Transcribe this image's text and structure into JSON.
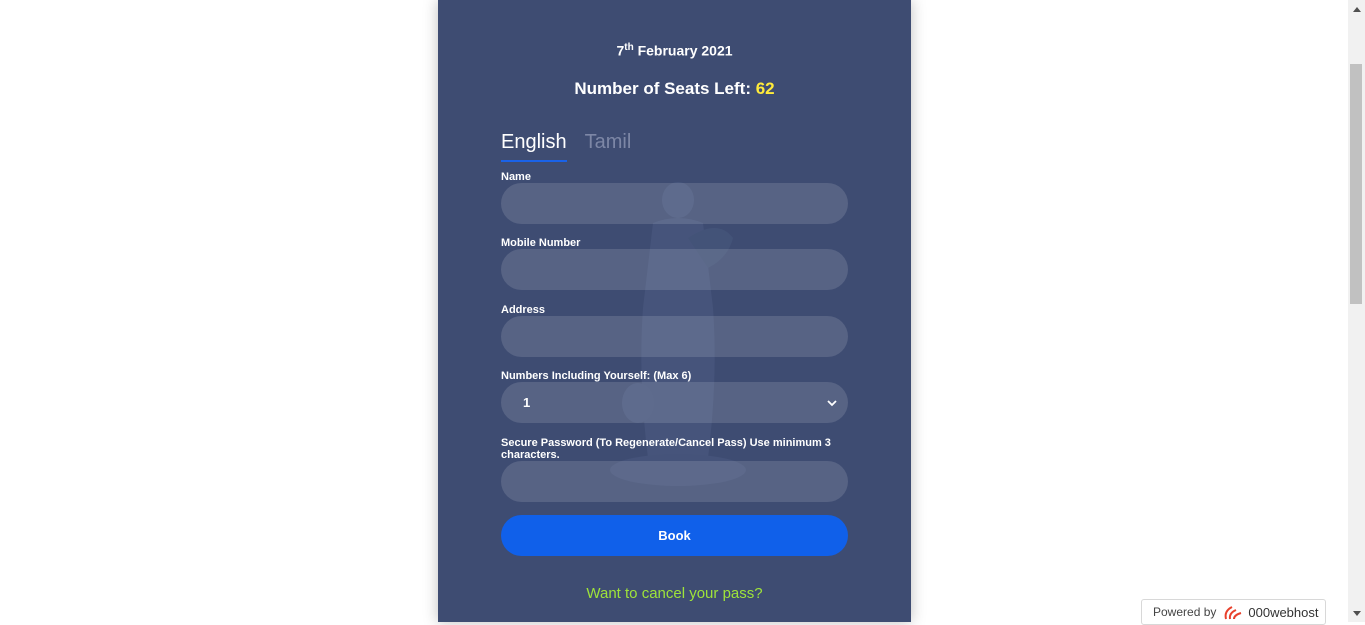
{
  "header": {
    "date_day": "7",
    "date_suffix": "th",
    "date_rest": " February 2021",
    "seats_label": "Number of Seats Left: ",
    "seats_count": "62"
  },
  "tabs": [
    {
      "label": "English",
      "active": true
    },
    {
      "label": "Tamil",
      "active": false
    }
  ],
  "form": {
    "name_label": "Name",
    "name_value": "",
    "mobile_label": "Mobile Number",
    "mobile_value": "",
    "address_label": "Address",
    "address_value": "",
    "numbers_label": "Numbers Including Yourself: (Max 6)",
    "numbers_selected": "1",
    "password_label": "Secure Password (To Regenerate/Cancel Pass) Use minimum 3 characters.",
    "password_value": "",
    "book_label": "Book",
    "cancel_link": "Want to cancel your pass?"
  },
  "badge": {
    "powered_by": "Powered by",
    "brand": "000webhost"
  },
  "colors": {
    "card_bg": "#3e4c72",
    "accent": "#1060ea",
    "seats_highlight": "#ffeb3b",
    "link": "#9ee33a"
  }
}
